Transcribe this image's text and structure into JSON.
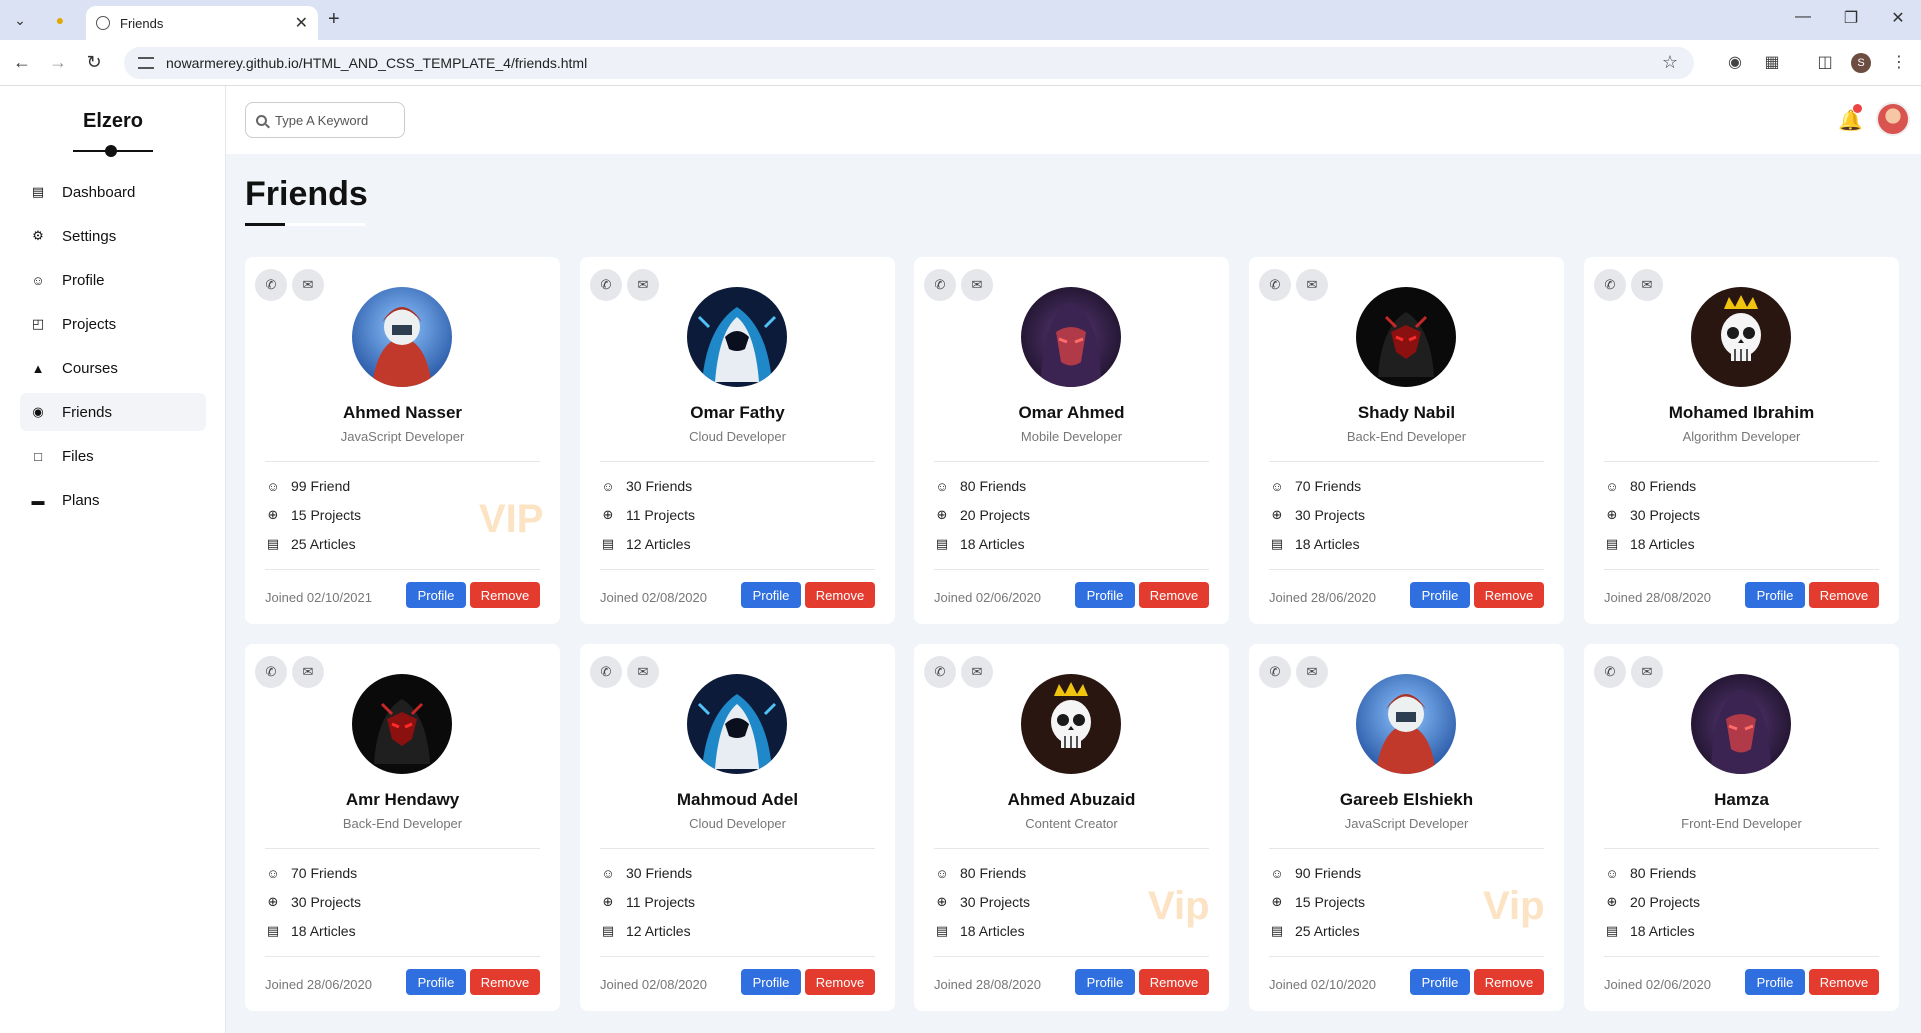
{
  "browser": {
    "tab_title": "Friends",
    "url": "nowarmerey.github.io/HTML_AND_CSS_TEMPLATE_4/friends.html",
    "profile_initial": "S"
  },
  "sidebar": {
    "logo": "Elzero",
    "items": [
      {
        "label": "Dashboard",
        "icon": "chart-icon"
      },
      {
        "label": "Settings",
        "icon": "gear-icon"
      },
      {
        "label": "Profile",
        "icon": "user-icon"
      },
      {
        "label": "Projects",
        "icon": "diagram-icon"
      },
      {
        "label": "Courses",
        "icon": "graduation-cap-icon"
      },
      {
        "label": "Friends",
        "icon": "user-circle-icon",
        "active": true
      },
      {
        "label": "Files",
        "icon": "file-icon"
      },
      {
        "label": "Plans",
        "icon": "credit-card-icon"
      }
    ]
  },
  "header": {
    "search_placeholder": "Type A Keyword"
  },
  "page": {
    "title": "Friends"
  },
  "friends": [
    {
      "name": "Ahmed Nasser",
      "role": "JavaScript Developer",
      "friends": "99 Friend",
      "projects": "15 Projects",
      "articles": "25 Articles",
      "vip": "VIP",
      "joined": "Joined 02/10/2021",
      "avatar": "red-hood"
    },
    {
      "name": "Omar Fathy",
      "role": "Cloud Developer",
      "friends": "30 Friends",
      "projects": "11 Projects",
      "articles": "12 Articles",
      "vip": "",
      "joined": "Joined 02/08/2020",
      "avatar": "blue-hood"
    },
    {
      "name": "Omar Ahmed",
      "role": "Mobile Developer",
      "friends": "80 Friends",
      "projects": "20 Projects",
      "articles": "18 Articles",
      "vip": "",
      "joined": "Joined 02/06/2020",
      "avatar": "purple-mask"
    },
    {
      "name": "Shady Nabil",
      "role": "Back-End Developer",
      "friends": "70 Friends",
      "projects": "30 Projects",
      "articles": "18 Articles",
      "vip": "",
      "joined": "Joined 28/06/2020",
      "avatar": "black-red"
    },
    {
      "name": "Mohamed Ibrahim",
      "role": "Algorithm Developer",
      "friends": "80 Friends",
      "projects": "30 Projects",
      "articles": "18 Articles",
      "vip": "",
      "joined": "Joined 28/08/2020",
      "avatar": "skull"
    },
    {
      "name": "Amr Hendawy",
      "role": "Back-End Developer",
      "friends": "70 Friends",
      "projects": "30 Projects",
      "articles": "18 Articles",
      "vip": "",
      "joined": "Joined 28/06/2020",
      "avatar": "black-red"
    },
    {
      "name": "Mahmoud Adel",
      "role": "Cloud Developer",
      "friends": "30 Friends",
      "projects": "11 Projects",
      "articles": "12 Articles",
      "vip": "",
      "joined": "Joined 02/08/2020",
      "avatar": "blue-hood"
    },
    {
      "name": "Ahmed Abuzaid",
      "role": "Content Creator",
      "friends": "80 Friends",
      "projects": "30 Projects",
      "articles": "18 Articles",
      "vip": "Vip",
      "joined": "Joined 28/08/2020",
      "avatar": "skull"
    },
    {
      "name": "Gareeb Elshiekh",
      "role": "JavaScript Developer",
      "friends": "90 Friends",
      "projects": "15 Projects",
      "articles": "25 Articles",
      "vip": "Vip",
      "joined": "Joined 02/10/2020",
      "avatar": "red-hood"
    },
    {
      "name": "Hamza",
      "role": "Front-End Developer",
      "friends": "80 Friends",
      "projects": "20 Projects",
      "articles": "18 Articles",
      "vip": "",
      "joined": "Joined 02/06/2020",
      "avatar": "purple-mask"
    }
  ],
  "card_buttons": {
    "profile": "Profile",
    "remove": "Remove"
  },
  "colors": {
    "profile_button": "#2f6fdf",
    "remove_button": "#e33b2e",
    "vip_text": "#fbe3c3",
    "background": "#f1f5f9"
  }
}
